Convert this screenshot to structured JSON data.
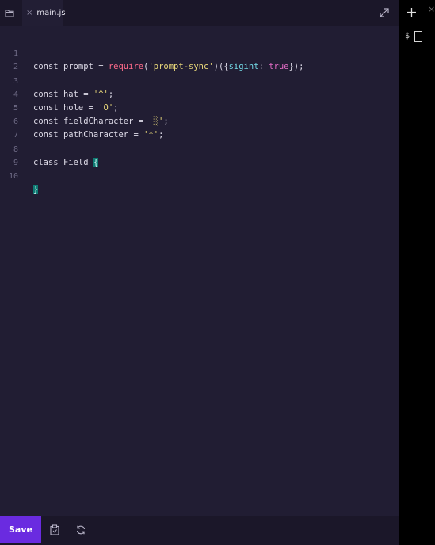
{
  "editor": {
    "tab": {
      "label": "main.js",
      "close_glyph": "×"
    },
    "line_numbers": [
      "1",
      "2",
      "3",
      "4",
      "5",
      "6",
      "7",
      "8",
      "9",
      "10"
    ],
    "code": {
      "l1": {
        "kw": "const ",
        "name": "prompt = ",
        "fn": "require",
        "paren": "(",
        "str": "'prompt-sync'",
        "mid": ")({",
        "prop": "sigint",
        "colon": ": ",
        "bool": "true",
        "end": "});"
      },
      "l3": {
        "kw": "const ",
        "name": "hat = ",
        "str": "'^'",
        "end": ";"
      },
      "l4": {
        "kw": "const ",
        "name": "hole = ",
        "str": "'O'",
        "end": ";"
      },
      "l5": {
        "kw": "const ",
        "name": "fieldCharacter = ",
        "str": "'░'",
        "end": ";"
      },
      "l6": {
        "kw": "const ",
        "name": "pathCharacter = ",
        "str": "'*'",
        "end": ";"
      },
      "l8": {
        "kw": "class ",
        "name": "Field ",
        "brace": "{"
      },
      "l10": {
        "brace": "}"
      }
    },
    "icons": [
      "folder-icon",
      "expand-icon"
    ]
  },
  "bottombar": {
    "save_label": "Save",
    "icons": [
      "clipboard-icon",
      "refresh-icon"
    ]
  },
  "terminal": {
    "close_glyph": "×",
    "prompt": "$",
    "icons": [
      "plus-icon"
    ]
  },
  "colors": {
    "editor_bg": "#211d33",
    "save_button": "#6a2be0",
    "string": "#e9d87a",
    "function": "#ff6b8b",
    "property": "#73d9e6",
    "boolean": "#e56cc7",
    "brace_highlight": "#0f7a73"
  }
}
